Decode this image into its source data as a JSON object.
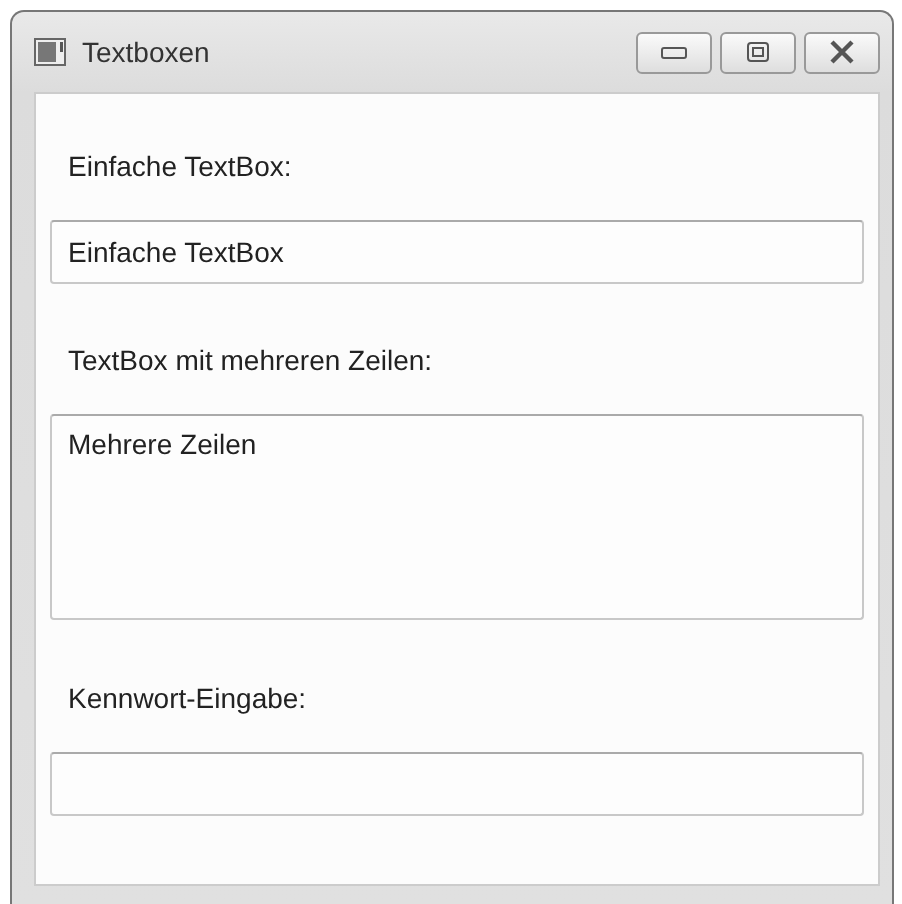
{
  "window": {
    "title": "Textboxen"
  },
  "controls": [
    {
      "label": "Einfache TextBox:",
      "field": {
        "kind": "text",
        "value": "Einfache TextBox"
      }
    },
    {
      "label": "TextBox mit mehreren Zeilen:",
      "field": {
        "kind": "multiline",
        "value": "Mehrere Zeilen"
      }
    },
    {
      "label": "Kennwort-Eingabe:",
      "field": {
        "kind": "password"
      }
    }
  ]
}
